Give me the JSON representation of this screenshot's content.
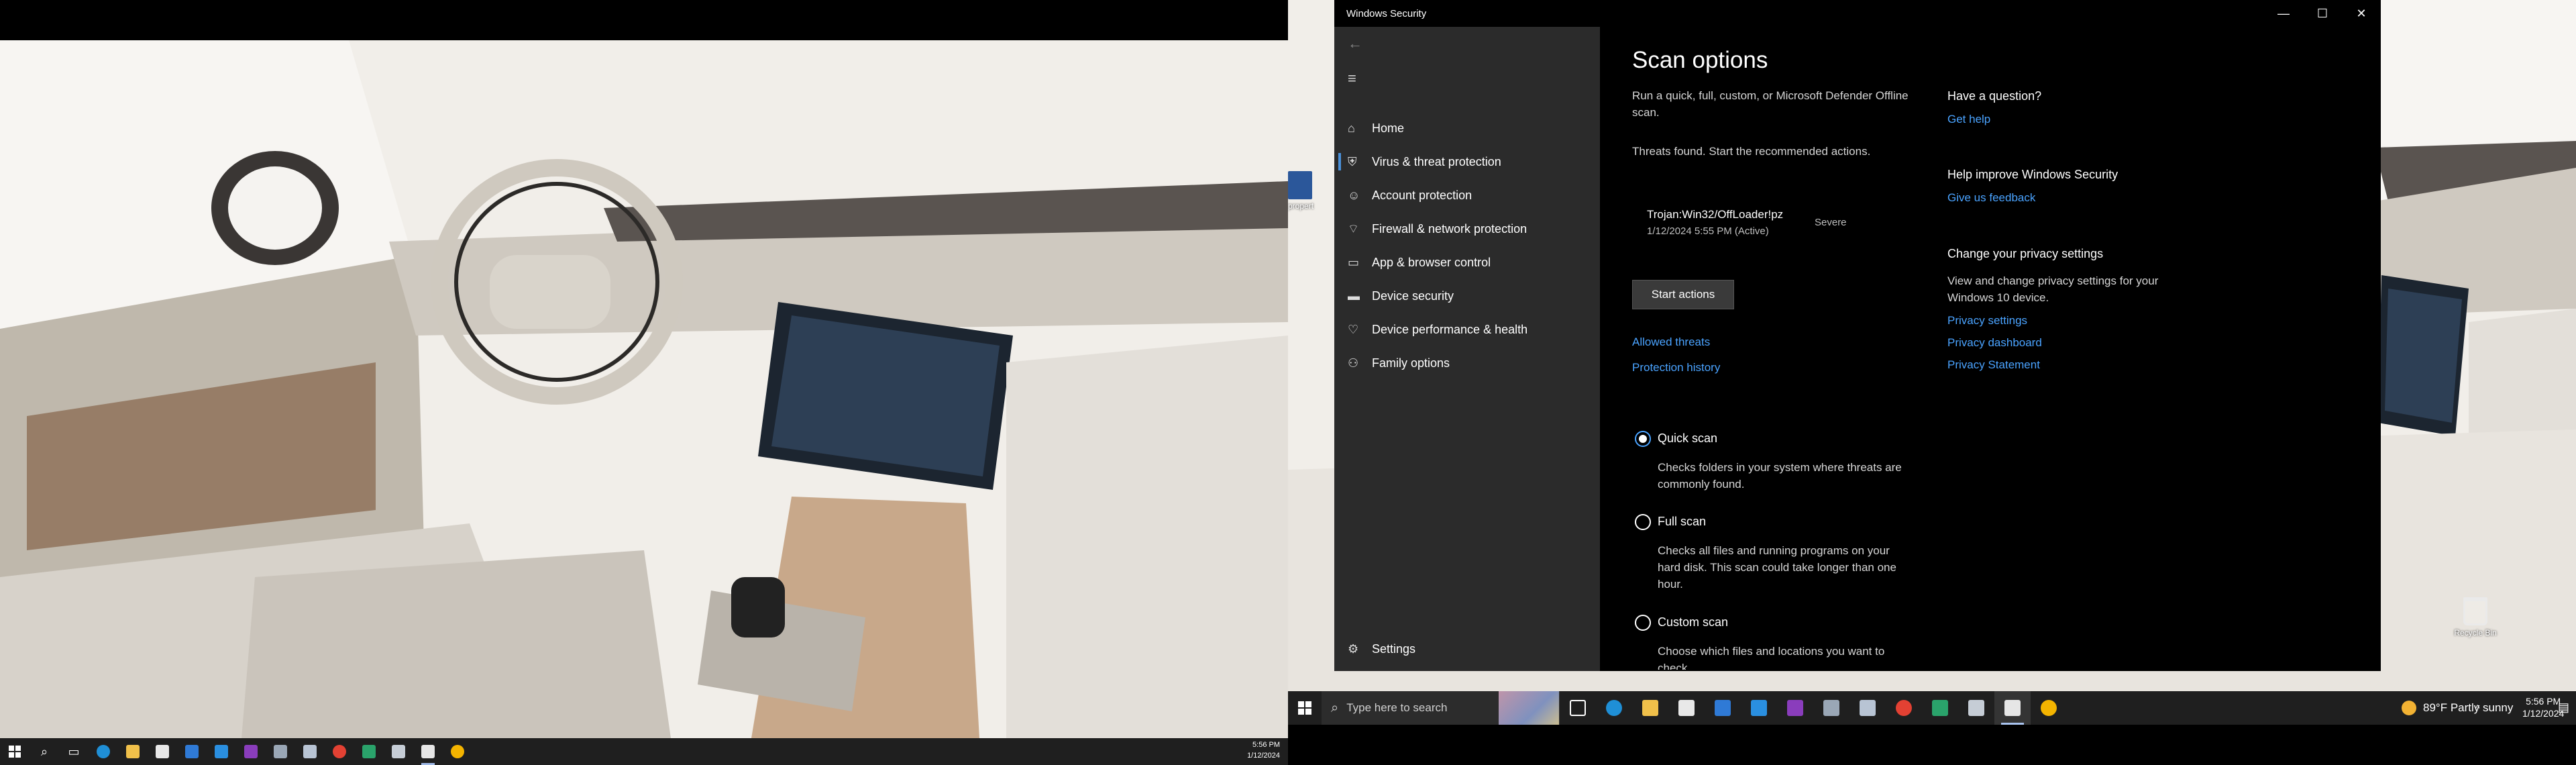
{
  "left_monitor": {
    "clock": {
      "time": "5:56 PM",
      "date": "1/12/2024"
    }
  },
  "right_monitor": {
    "desktop_icons": {
      "recycle_bin": "Recycle Bin",
      "partial_label": "propert"
    },
    "taskbar": {
      "search_placeholder": "Type here to search",
      "weather": "89°F  Partly sunny",
      "clock": {
        "time": "5:56 PM",
        "date": "1/12/2024"
      }
    }
  },
  "window": {
    "title": "Windows Security",
    "nav": {
      "items": [
        {
          "label": "Home",
          "icon": "home-icon"
        },
        {
          "label": "Virus & threat protection",
          "icon": "shield-icon",
          "selected": true
        },
        {
          "label": "Account protection",
          "icon": "person-icon"
        },
        {
          "label": "Firewall & network protection",
          "icon": "wifi-icon"
        },
        {
          "label": "App & browser control",
          "icon": "browser-icon"
        },
        {
          "label": "Device security",
          "icon": "laptop-icon"
        },
        {
          "label": "Device performance & health",
          "icon": "heart-icon"
        },
        {
          "label": "Family options",
          "icon": "family-icon"
        }
      ],
      "settings": "Settings"
    },
    "main": {
      "title": "Scan options",
      "intro": "Run a quick, full, custom, or Microsoft Defender Offline scan.",
      "threats_msg": "Threats found. Start the recommended actions.",
      "threat": {
        "name": "Trojan:Win32/OffLoader!pz",
        "date": "1/12/2024 5:55 PM (Active)",
        "severity": "Severe"
      },
      "start_actions": "Start actions",
      "allowed_threats": "Allowed threats",
      "protection_history": "Protection history",
      "scan_types": [
        {
          "label": "Quick scan",
          "desc": "Checks folders in your system where threats are commonly found.",
          "checked": true
        },
        {
          "label": "Full scan",
          "desc": "Checks all files and running programs on your hard disk. This scan could take longer than one hour.",
          "checked": false
        },
        {
          "label": "Custom scan",
          "desc": "Choose which files and locations you want to check.",
          "checked": false
        }
      ]
    },
    "side": {
      "question": "Have a question?",
      "get_help": "Get help",
      "improve": "Help improve Windows Security",
      "feedback": "Give us feedback",
      "privacy_title": "Change your privacy settings",
      "privacy_text": "View and change privacy settings for your Windows 10 device.",
      "privacy_settings": "Privacy settings",
      "privacy_dashboard": "Privacy dashboard",
      "privacy_statement": "Privacy Statement"
    }
  }
}
